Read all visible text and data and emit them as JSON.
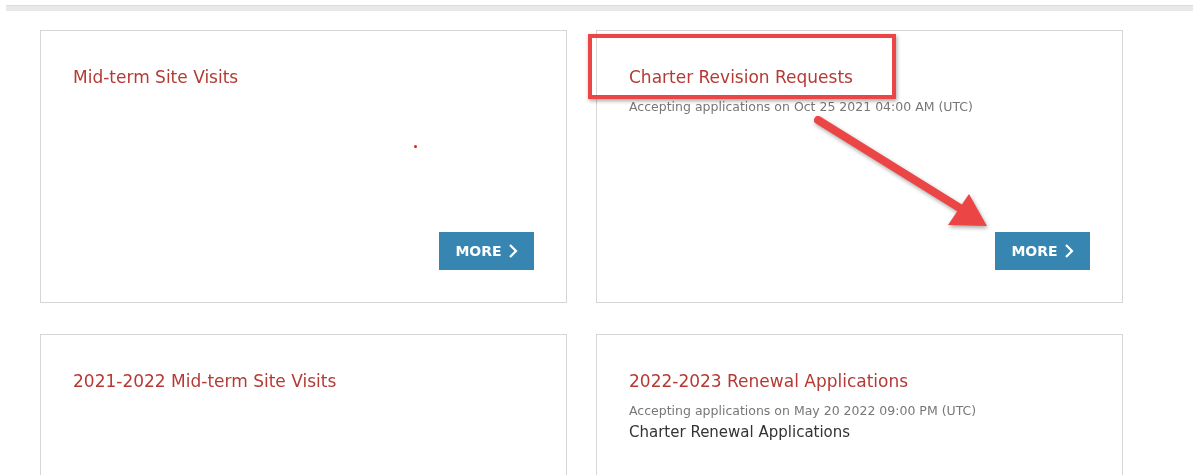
{
  "cards": [
    {
      "title": "Mid-term Site Visits",
      "button": "MORE",
      "annotations": [
        {
          "kind": "dot"
        }
      ]
    },
    {
      "title": "Charter Revision Requests",
      "subtitle": "Accepting applications on Oct 25 2021 04:00 AM (UTC)",
      "button": "MORE",
      "annotations": [
        {
          "kind": "highlight-box"
        },
        {
          "kind": "arrow"
        }
      ]
    },
    {
      "title": "2021-2022 Mid-term Site Visits"
    },
    {
      "title": "2022-2023 Renewal Applications",
      "subtitle": "Accepting applications on May 20 2022 09:00 PM (UTC)",
      "description": "Charter Renewal Applications"
    }
  ]
}
